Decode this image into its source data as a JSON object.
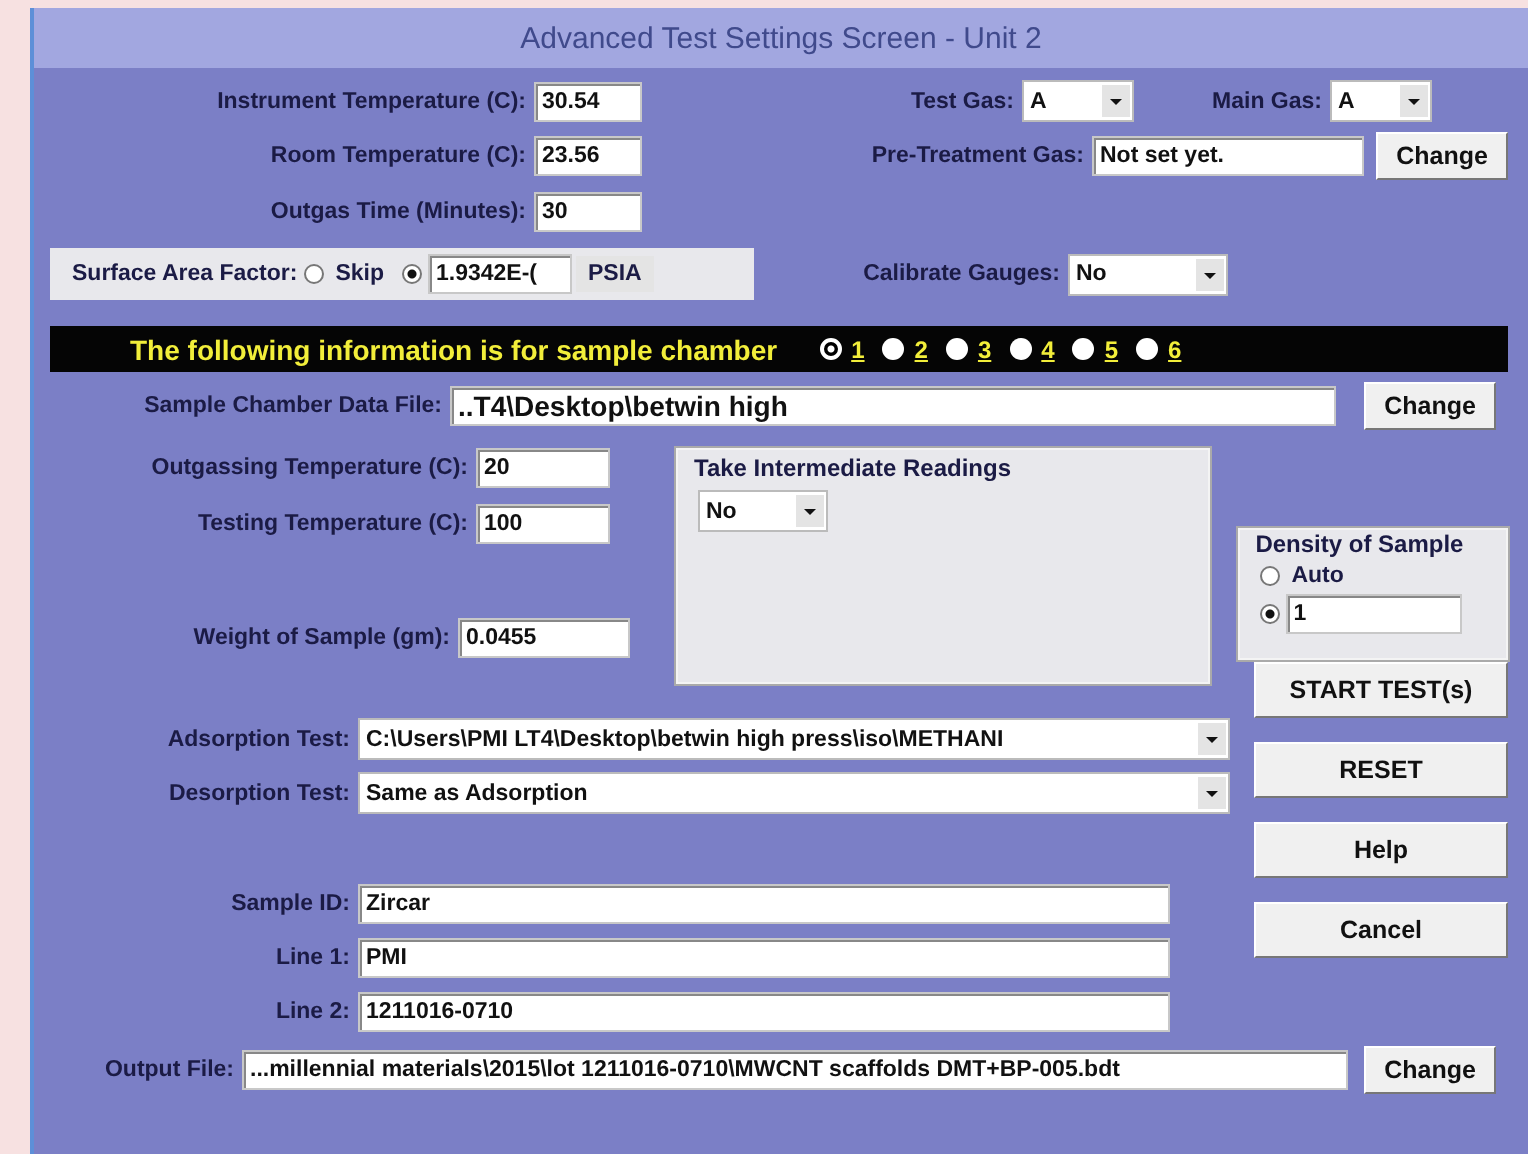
{
  "window": {
    "title": "Advanced Test Settings Screen - Unit 2"
  },
  "instrument_temperature": {
    "label": "Instrument Temperature (C):",
    "value": "30.54"
  },
  "room_temperature": {
    "label": "Room Temperature (C):",
    "value": "23.56"
  },
  "outgas_time": {
    "label": "Outgas Time (Minutes):",
    "value": "30"
  },
  "test_gas": {
    "label": "Test Gas:",
    "value": "A"
  },
  "main_gas": {
    "label": "Main Gas:",
    "value": "A"
  },
  "pre_treatment_gas": {
    "label": "Pre-Treatment Gas:",
    "value": "Not set yet.",
    "button": "Change"
  },
  "surface_area_factor": {
    "label": "Surface Area Factor:",
    "options": [
      {
        "label": "Skip",
        "selected": false
      },
      {
        "value": "1.9342E-(",
        "selected": true
      }
    ],
    "unit": "PSIA"
  },
  "calibrate_gauges": {
    "label": "Calibrate Gauges:",
    "value": "No"
  },
  "chamber_band": {
    "text": "The following information is for sample chamber",
    "chambers": [
      {
        "label": "1",
        "selected": true
      },
      {
        "label": "2",
        "selected": false
      },
      {
        "label": "3",
        "selected": false
      },
      {
        "label": "4",
        "selected": false
      },
      {
        "label": "5",
        "selected": false
      },
      {
        "label": "6",
        "selected": false
      }
    ]
  },
  "sample_chamber_data_file": {
    "label": "Sample Chamber Data File:",
    "value": "..T4\\Desktop\\betwin high",
    "button": "Change"
  },
  "outgassing_temperature": {
    "label": "Outgassing Temperature (C):",
    "value": "20"
  },
  "testing_temperature": {
    "label": "Testing Temperature (C):",
    "value": "100"
  },
  "weight_of_sample": {
    "label": "Weight of Sample (gm):",
    "value": "0.0455"
  },
  "intermediate_readings": {
    "title": "Take Intermediate Readings",
    "value": "No"
  },
  "density_of_sample": {
    "title": "Density of Sample",
    "options": [
      {
        "label": "Auto",
        "selected": false
      },
      {
        "value": "1",
        "selected": true
      }
    ]
  },
  "adsorption_test": {
    "label": "Adsorption Test:",
    "value": "C:\\Users\\PMI LT4\\Desktop\\betwin high press\\iso\\METHANI"
  },
  "desorption_test": {
    "label": "Desorption Test:",
    "value": "Same as Adsorption"
  },
  "sample_id": {
    "label": "Sample ID:",
    "value": "Zircar"
  },
  "line_1": {
    "label": "Line 1:",
    "value": "PMI"
  },
  "line_2": {
    "label": "Line 2:",
    "value": "1211016-0710"
  },
  "output_file": {
    "label": "Output File:",
    "value": "...millennial materials\\2015\\lot 1211016-0710\\MWCNT scaffolds DMT+BP-005.bdt",
    "button": "Change"
  },
  "buttons": [
    "START TEST(s)",
    "RESET",
    "Help",
    "Cancel"
  ]
}
